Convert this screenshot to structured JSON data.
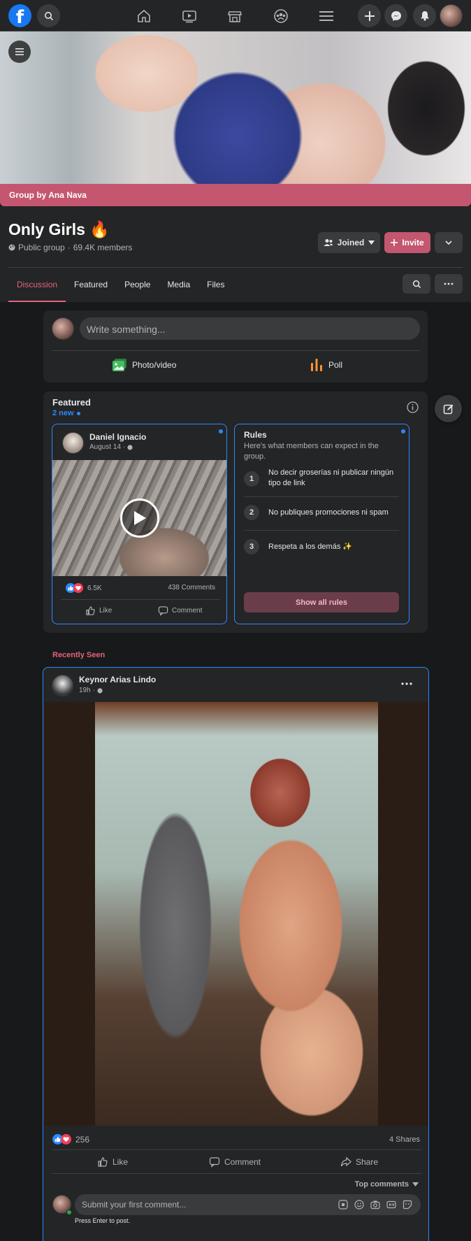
{
  "nav": {
    "logo": "f",
    "icons": [
      "search-icon",
      "home-icon",
      "watch-icon",
      "marketplace-icon",
      "groups-icon",
      "menu-icon",
      "plus-icon",
      "messenger-icon",
      "notifications-icon",
      "profile-avatar"
    ]
  },
  "cover": {
    "group_by": "Group by Ana Nava"
  },
  "group": {
    "name": "Only Girls 🔥",
    "privacy": "Public group",
    "separator": "·",
    "members": "69.4K members",
    "joined_label": "Joined",
    "invite_label": "Invite"
  },
  "tabs": [
    {
      "label": "Discussion",
      "active": true
    },
    {
      "label": "Featured",
      "active": false
    },
    {
      "label": "People",
      "active": false
    },
    {
      "label": "Media",
      "active": false
    },
    {
      "label": "Files",
      "active": false
    }
  ],
  "composer": {
    "placeholder": "Write something...",
    "photo_label": "Photo/video",
    "poll_label": "Poll"
  },
  "featured": {
    "title": "Featured",
    "new_count": "2 new",
    "post": {
      "author": "Daniel Ignacio",
      "date": "August 14 ·",
      "reactions": "6.5K",
      "comments": "438 Comments",
      "like_label": "Like",
      "comment_label": "Comment"
    },
    "rules": {
      "title": "Rules",
      "subtitle": "Here's what members can expect in the group.",
      "items": [
        {
          "num": "1",
          "text": "No decir groserías ni publicar ningún tipo de link"
        },
        {
          "num": "2",
          "text": "No publiques promociones ni spam"
        },
        {
          "num": "3",
          "text": "Respeta a los demás ✨"
        }
      ],
      "show_all": "Show all rules"
    }
  },
  "recently_seen": "Recently Seen",
  "post": {
    "author": "Keynor Arias Lindo",
    "time": "19h ·",
    "reactions": "256",
    "shares": "4 Shares",
    "like_label": "Like",
    "comment_label": "Comment",
    "share_label": "Share",
    "top_comments": "Top comments",
    "comment_placeholder": "Submit your first comment...",
    "press_enter": "Press Enter to post."
  },
  "colors": {
    "accent": "#e4637f",
    "group_bar": "#c4566f",
    "blue": "#2d88ff",
    "bg": "#18191a",
    "card": "#242526"
  }
}
